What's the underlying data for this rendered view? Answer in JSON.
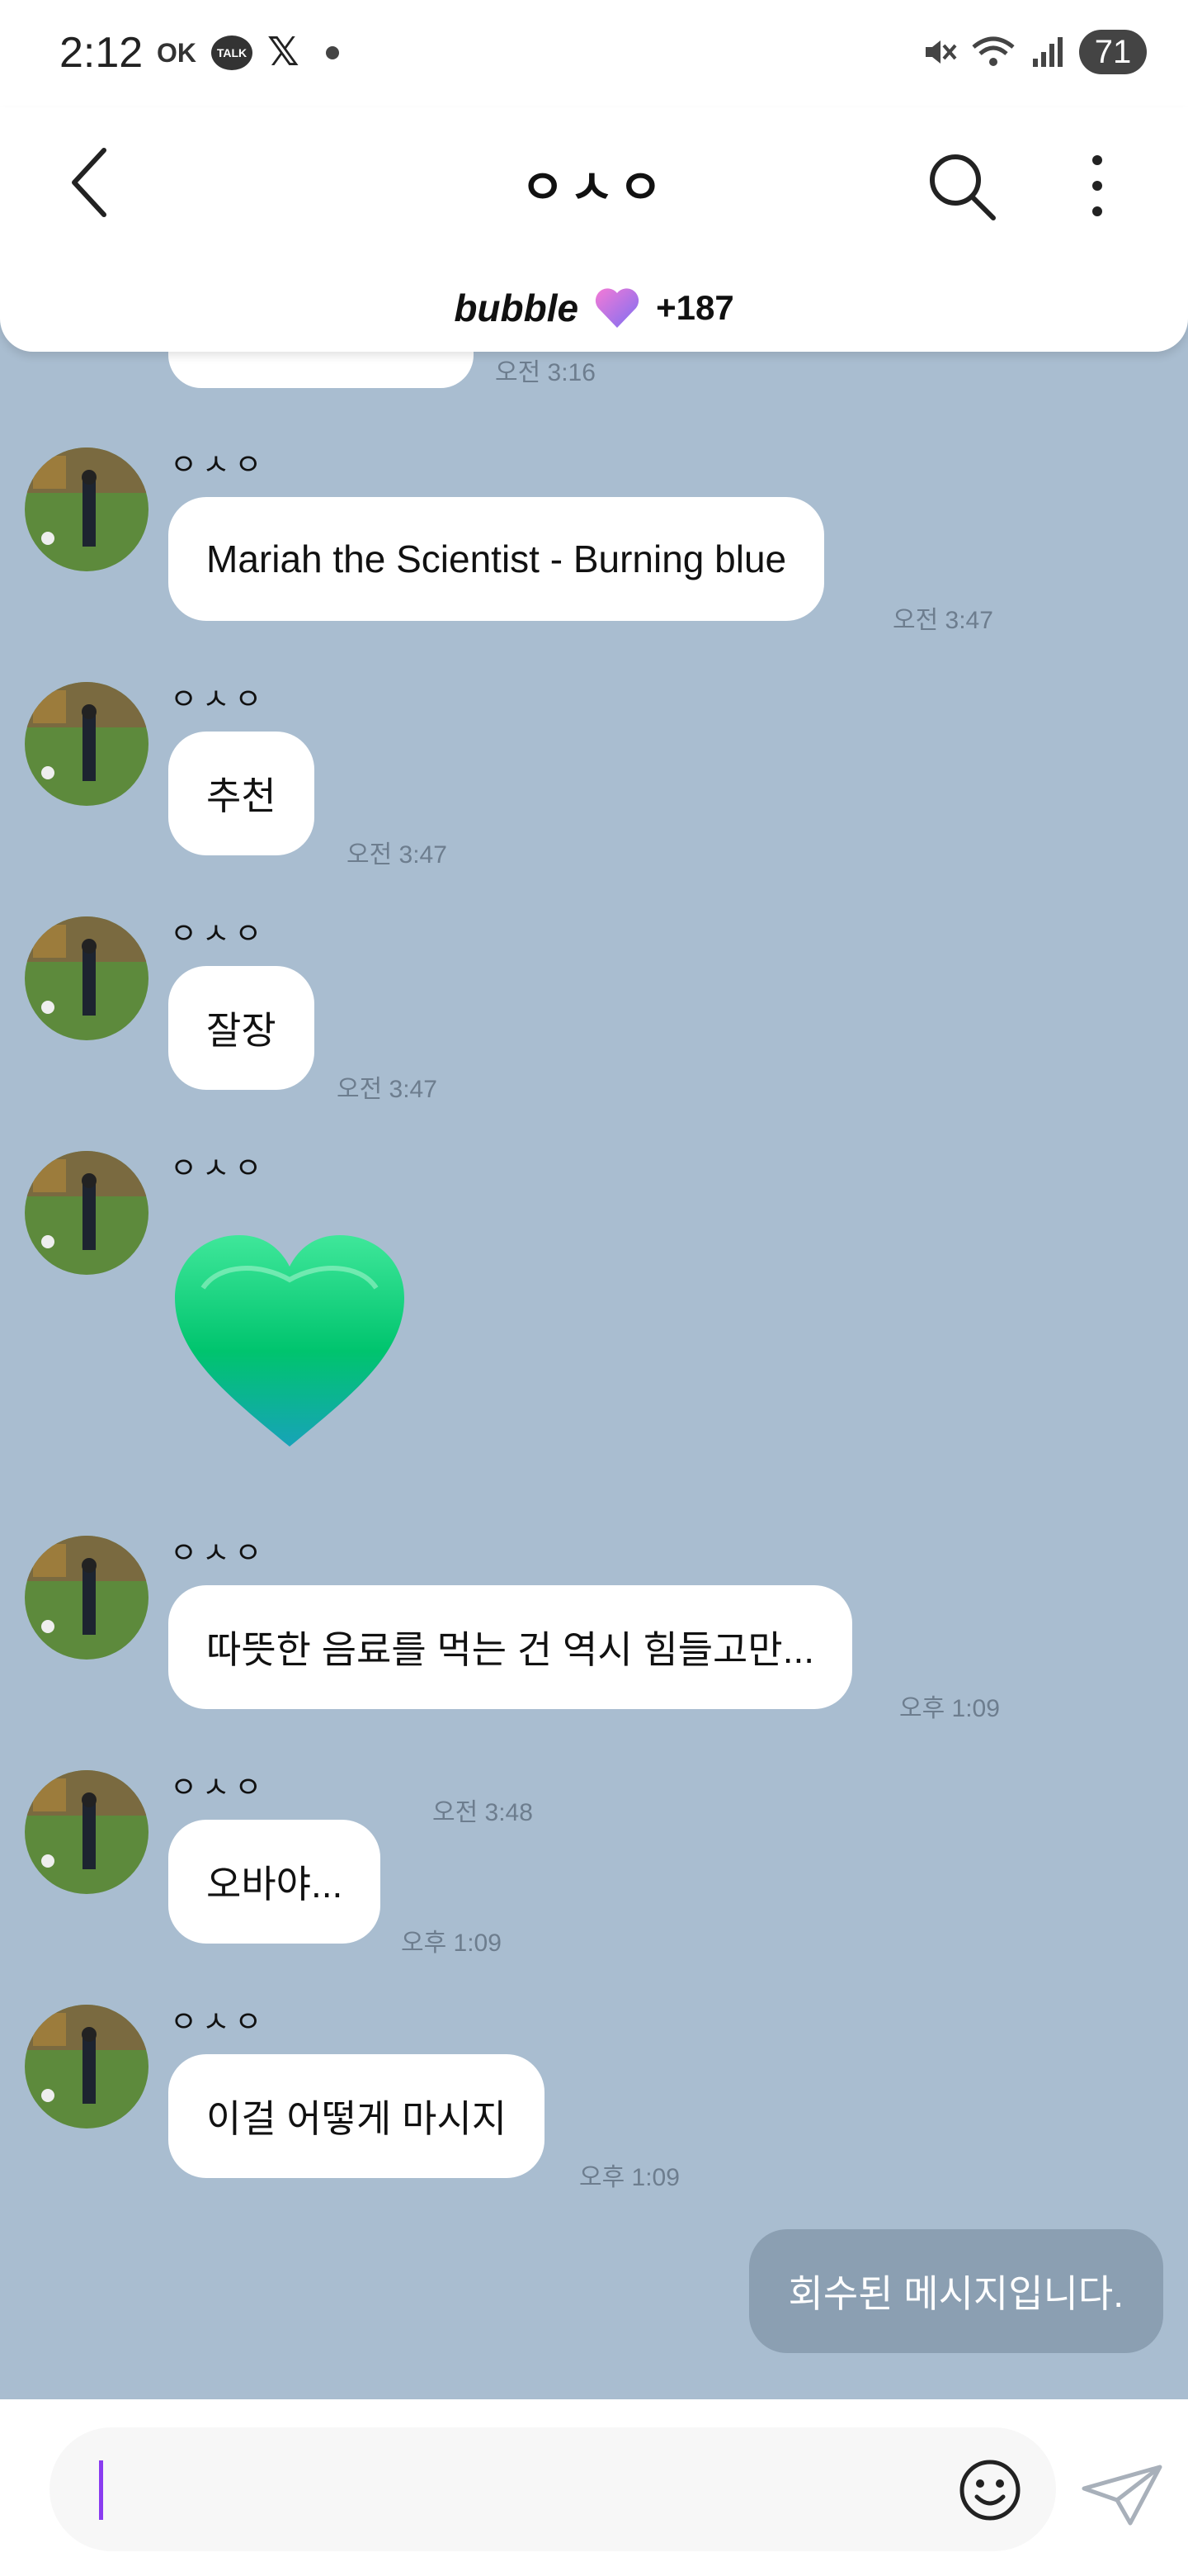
{
  "status_bar": {
    "time": "2:12",
    "ok_label": "OK",
    "talk_label": "TALK",
    "x_label": "𝕏",
    "battery": "71"
  },
  "header": {
    "title": "ㅇㅅㅇ",
    "bubble_label": "bubble",
    "bubble_count": "+187"
  },
  "chat": {
    "partial_time": "오전 3:16",
    "messages": [
      {
        "sender": "ㅇㅅㅇ",
        "text": "Mariah the Scientist - Burning blue",
        "time": "오전 3:47"
      },
      {
        "sender": "ㅇㅅㅇ",
        "text": "추천",
        "time": "오전 3:47"
      },
      {
        "sender": "ㅇㅅㅇ",
        "text": "잘장",
        "time": "오전 3:47"
      },
      {
        "sender": "ㅇㅅㅇ",
        "sticker": "green-heart",
        "time": "오전 3:48"
      },
      {
        "sender": "ㅇㅅㅇ",
        "text": "따뜻한 음료를 먹는 건 역시 힘들고만...",
        "time": "오후 1:09"
      },
      {
        "sender": "ㅇㅅㅇ",
        "text": "오바야...",
        "time": "오후 1:09"
      },
      {
        "sender": "ㅇㅅㅇ",
        "text": "이걸 어떻게 마시지",
        "time": "오후 1:09"
      }
    ],
    "my_message": "회수된 메시지입니다."
  },
  "input": {
    "placeholder": ""
  },
  "colors": {
    "chat_bg": "#a9bdd0",
    "cursor": "#8a3cf0",
    "retracted_bubble": "#8b9fb2"
  }
}
